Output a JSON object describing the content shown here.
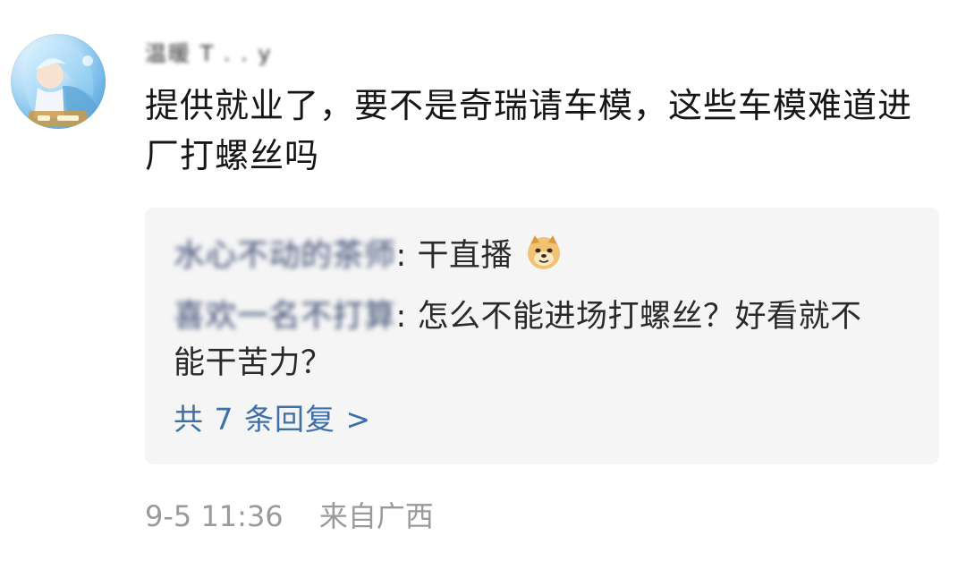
{
  "comment": {
    "username": "温暖 T . . y",
    "text": "提供就业了，要不是奇瑞请车模，这些车模难道进厂打螺丝吗",
    "avatar_icon": "avatar-anime-character",
    "time": "9-5 11:36",
    "location": "来自广西"
  },
  "replies": [
    {
      "author": "水心不动的茶师",
      "separator": ":",
      "text": "干直播",
      "emoji": "doge-icon"
    },
    {
      "author": "喜欢一名不打算",
      "separator": ":",
      "text": "怎么不能进场打螺丝？好看就不能干苦力？"
    }
  ],
  "more_replies_label": "共 7 条回复 >",
  "colors": {
    "link": "#3d6fa8",
    "meta": "#9a9a9a",
    "reply_bg": "#f5f5f5"
  }
}
